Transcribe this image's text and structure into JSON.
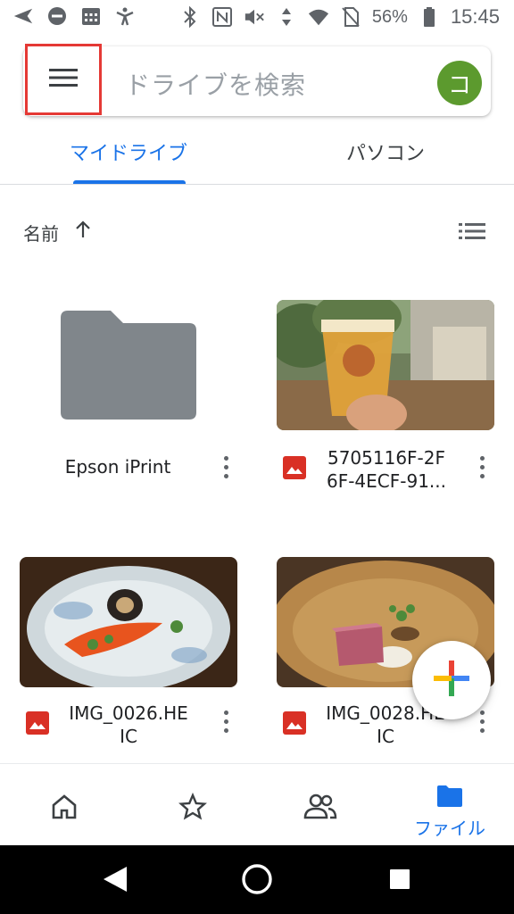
{
  "status_bar": {
    "battery_percent": "56%",
    "time": "15:45"
  },
  "search": {
    "placeholder": "ドライブを検索",
    "avatar_letter": "コ"
  },
  "tabs": [
    {
      "label": "マイドライブ",
      "active": true
    },
    {
      "label": "パソコン",
      "active": false
    }
  ],
  "sort": {
    "label": "名前"
  },
  "files": [
    {
      "name": "Epson iPrint",
      "type": "folder"
    },
    {
      "name_line1": "5705116F-2F",
      "name_line2": "6F-4ECF-91...",
      "type": "image"
    },
    {
      "name_line1": "IMG_0026.HE",
      "name_line2": "IC",
      "type": "image"
    },
    {
      "name_line1": "IMG_0028.HE",
      "name_line2": "IC",
      "type": "image"
    }
  ],
  "bottom_nav": {
    "items": [
      {
        "icon": "home-icon",
        "label": ""
      },
      {
        "icon": "star-icon",
        "label": ""
      },
      {
        "icon": "shared-icon",
        "label": ""
      },
      {
        "icon": "folder-icon",
        "label": "ファイル"
      }
    ],
    "active_color": "#1a73e8"
  },
  "colors": {
    "accent": "#1a73e8",
    "avatar": "#5c9a2e",
    "highlight_box": "#e53935",
    "folder": "#80868b",
    "image_file_icon": "#d93025"
  }
}
